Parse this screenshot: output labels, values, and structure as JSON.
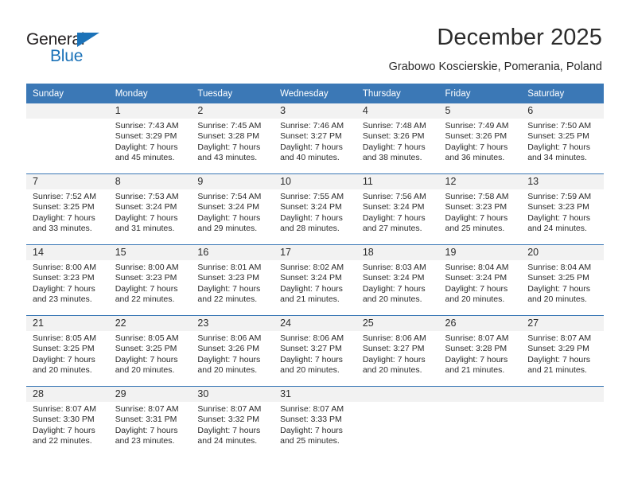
{
  "brand": {
    "name_top": "General",
    "name_bottom": "Blue",
    "triangle_color": "#1b72b8"
  },
  "header": {
    "month_title": "December 2025",
    "location": "Grabowo Koscierskie, Pomerania, Poland"
  },
  "theme": {
    "header_blue": "#3b78b6",
    "daynum_band": "#f2f2f2",
    "text": "#2b2b2b"
  },
  "weekday_headers": [
    "Sunday",
    "Monday",
    "Tuesday",
    "Wednesday",
    "Thursday",
    "Friday",
    "Saturday"
  ],
  "weeks": [
    {
      "days": [
        {
          "day": "",
          "sunrise": "",
          "sunset": "",
          "daylight_line1": "",
          "daylight_line2": "",
          "empty": true
        },
        {
          "day": "1",
          "sunrise": "Sunrise: 7:43 AM",
          "sunset": "Sunset: 3:29 PM",
          "daylight_line1": "Daylight: 7 hours",
          "daylight_line2": "and 45 minutes."
        },
        {
          "day": "2",
          "sunrise": "Sunrise: 7:45 AM",
          "sunset": "Sunset: 3:28 PM",
          "daylight_line1": "Daylight: 7 hours",
          "daylight_line2": "and 43 minutes."
        },
        {
          "day": "3",
          "sunrise": "Sunrise: 7:46 AM",
          "sunset": "Sunset: 3:27 PM",
          "daylight_line1": "Daylight: 7 hours",
          "daylight_line2": "and 40 minutes."
        },
        {
          "day": "4",
          "sunrise": "Sunrise: 7:48 AM",
          "sunset": "Sunset: 3:26 PM",
          "daylight_line1": "Daylight: 7 hours",
          "daylight_line2": "and 38 minutes."
        },
        {
          "day": "5",
          "sunrise": "Sunrise: 7:49 AM",
          "sunset": "Sunset: 3:26 PM",
          "daylight_line1": "Daylight: 7 hours",
          "daylight_line2": "and 36 minutes."
        },
        {
          "day": "6",
          "sunrise": "Sunrise: 7:50 AM",
          "sunset": "Sunset: 3:25 PM",
          "daylight_line1": "Daylight: 7 hours",
          "daylight_line2": "and 34 minutes."
        }
      ]
    },
    {
      "days": [
        {
          "day": "7",
          "sunrise": "Sunrise: 7:52 AM",
          "sunset": "Sunset: 3:25 PM",
          "daylight_line1": "Daylight: 7 hours",
          "daylight_line2": "and 33 minutes."
        },
        {
          "day": "8",
          "sunrise": "Sunrise: 7:53 AM",
          "sunset": "Sunset: 3:24 PM",
          "daylight_line1": "Daylight: 7 hours",
          "daylight_line2": "and 31 minutes."
        },
        {
          "day": "9",
          "sunrise": "Sunrise: 7:54 AM",
          "sunset": "Sunset: 3:24 PM",
          "daylight_line1": "Daylight: 7 hours",
          "daylight_line2": "and 29 minutes."
        },
        {
          "day": "10",
          "sunrise": "Sunrise: 7:55 AM",
          "sunset": "Sunset: 3:24 PM",
          "daylight_line1": "Daylight: 7 hours",
          "daylight_line2": "and 28 minutes."
        },
        {
          "day": "11",
          "sunrise": "Sunrise: 7:56 AM",
          "sunset": "Sunset: 3:24 PM",
          "daylight_line1": "Daylight: 7 hours",
          "daylight_line2": "and 27 minutes."
        },
        {
          "day": "12",
          "sunrise": "Sunrise: 7:58 AM",
          "sunset": "Sunset: 3:23 PM",
          "daylight_line1": "Daylight: 7 hours",
          "daylight_line2": "and 25 minutes."
        },
        {
          "day": "13",
          "sunrise": "Sunrise: 7:59 AM",
          "sunset": "Sunset: 3:23 PM",
          "daylight_line1": "Daylight: 7 hours",
          "daylight_line2": "and 24 minutes."
        }
      ]
    },
    {
      "days": [
        {
          "day": "14",
          "sunrise": "Sunrise: 8:00 AM",
          "sunset": "Sunset: 3:23 PM",
          "daylight_line1": "Daylight: 7 hours",
          "daylight_line2": "and 23 minutes."
        },
        {
          "day": "15",
          "sunrise": "Sunrise: 8:00 AM",
          "sunset": "Sunset: 3:23 PM",
          "daylight_line1": "Daylight: 7 hours",
          "daylight_line2": "and 22 minutes."
        },
        {
          "day": "16",
          "sunrise": "Sunrise: 8:01 AM",
          "sunset": "Sunset: 3:23 PM",
          "daylight_line1": "Daylight: 7 hours",
          "daylight_line2": "and 22 minutes."
        },
        {
          "day": "17",
          "sunrise": "Sunrise: 8:02 AM",
          "sunset": "Sunset: 3:24 PM",
          "daylight_line1": "Daylight: 7 hours",
          "daylight_line2": "and 21 minutes."
        },
        {
          "day": "18",
          "sunrise": "Sunrise: 8:03 AM",
          "sunset": "Sunset: 3:24 PM",
          "daylight_line1": "Daylight: 7 hours",
          "daylight_line2": "and 20 minutes."
        },
        {
          "day": "19",
          "sunrise": "Sunrise: 8:04 AM",
          "sunset": "Sunset: 3:24 PM",
          "daylight_line1": "Daylight: 7 hours",
          "daylight_line2": "and 20 minutes."
        },
        {
          "day": "20",
          "sunrise": "Sunrise: 8:04 AM",
          "sunset": "Sunset: 3:25 PM",
          "daylight_line1": "Daylight: 7 hours",
          "daylight_line2": "and 20 minutes."
        }
      ]
    },
    {
      "days": [
        {
          "day": "21",
          "sunrise": "Sunrise: 8:05 AM",
          "sunset": "Sunset: 3:25 PM",
          "daylight_line1": "Daylight: 7 hours",
          "daylight_line2": "and 20 minutes."
        },
        {
          "day": "22",
          "sunrise": "Sunrise: 8:05 AM",
          "sunset": "Sunset: 3:25 PM",
          "daylight_line1": "Daylight: 7 hours",
          "daylight_line2": "and 20 minutes."
        },
        {
          "day": "23",
          "sunrise": "Sunrise: 8:06 AM",
          "sunset": "Sunset: 3:26 PM",
          "daylight_line1": "Daylight: 7 hours",
          "daylight_line2": "and 20 minutes."
        },
        {
          "day": "24",
          "sunrise": "Sunrise: 8:06 AM",
          "sunset": "Sunset: 3:27 PM",
          "daylight_line1": "Daylight: 7 hours",
          "daylight_line2": "and 20 minutes."
        },
        {
          "day": "25",
          "sunrise": "Sunrise: 8:06 AM",
          "sunset": "Sunset: 3:27 PM",
          "daylight_line1": "Daylight: 7 hours",
          "daylight_line2": "and 20 minutes."
        },
        {
          "day": "26",
          "sunrise": "Sunrise: 8:07 AM",
          "sunset": "Sunset: 3:28 PM",
          "daylight_line1": "Daylight: 7 hours",
          "daylight_line2": "and 21 minutes."
        },
        {
          "day": "27",
          "sunrise": "Sunrise: 8:07 AM",
          "sunset": "Sunset: 3:29 PM",
          "daylight_line1": "Daylight: 7 hours",
          "daylight_line2": "and 21 minutes."
        }
      ]
    },
    {
      "days": [
        {
          "day": "28",
          "sunrise": "Sunrise: 8:07 AM",
          "sunset": "Sunset: 3:30 PM",
          "daylight_line1": "Daylight: 7 hours",
          "daylight_line2": "and 22 minutes."
        },
        {
          "day": "29",
          "sunrise": "Sunrise: 8:07 AM",
          "sunset": "Sunset: 3:31 PM",
          "daylight_line1": "Daylight: 7 hours",
          "daylight_line2": "and 23 minutes."
        },
        {
          "day": "30",
          "sunrise": "Sunrise: 8:07 AM",
          "sunset": "Sunset: 3:32 PM",
          "daylight_line1": "Daylight: 7 hours",
          "daylight_line2": "and 24 minutes."
        },
        {
          "day": "31",
          "sunrise": "Sunrise: 8:07 AM",
          "sunset": "Sunset: 3:33 PM",
          "daylight_line1": "Daylight: 7 hours",
          "daylight_line2": "and 25 minutes."
        },
        {
          "day": "",
          "sunrise": "",
          "sunset": "",
          "daylight_line1": "",
          "daylight_line2": "",
          "empty": true
        },
        {
          "day": "",
          "sunrise": "",
          "sunset": "",
          "daylight_line1": "",
          "daylight_line2": "",
          "empty": true
        },
        {
          "day": "",
          "sunrise": "",
          "sunset": "",
          "daylight_line1": "",
          "daylight_line2": "",
          "empty": true
        }
      ]
    }
  ]
}
